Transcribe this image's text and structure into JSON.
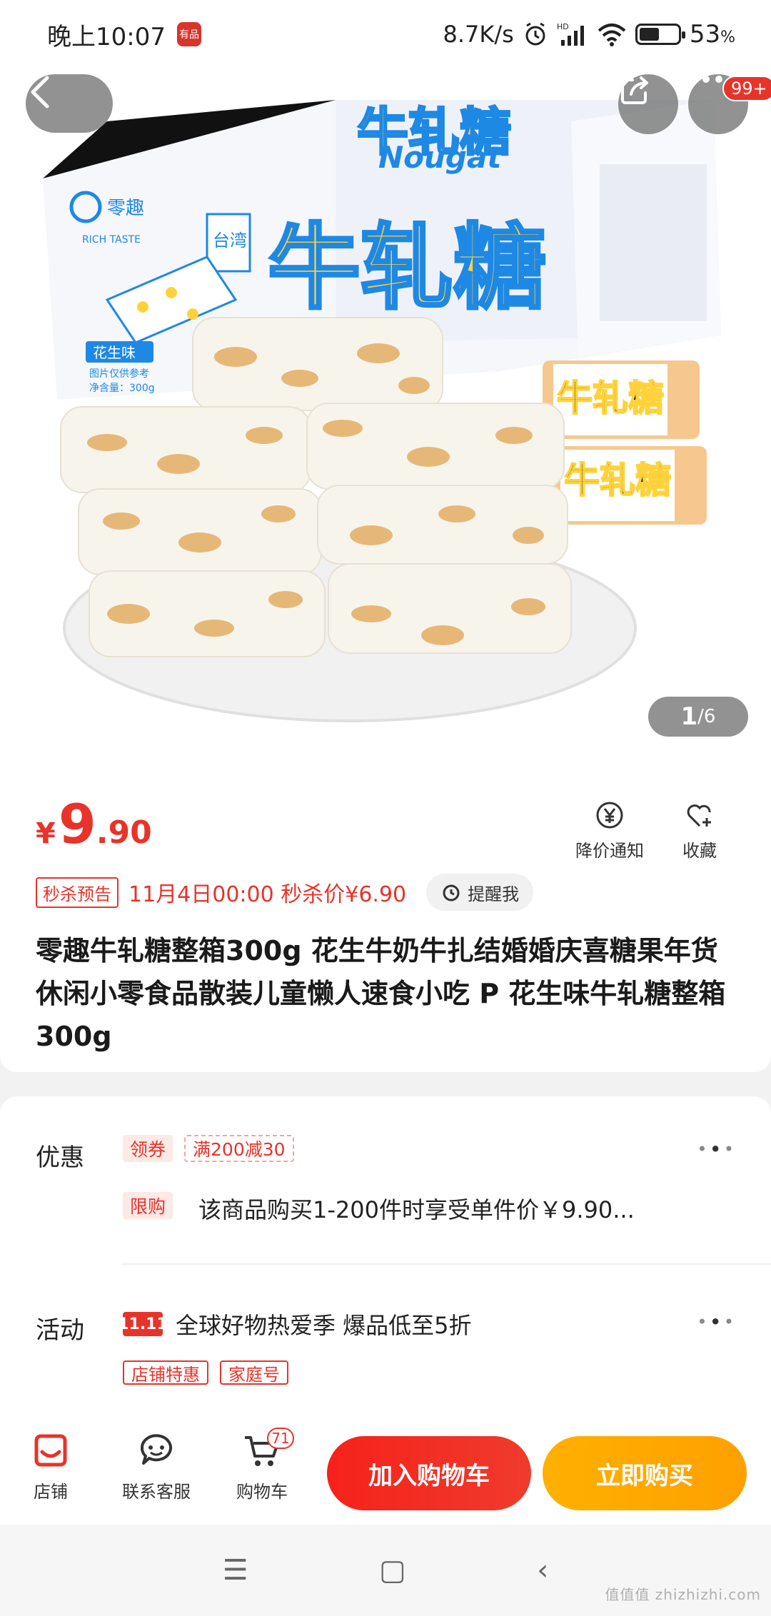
{
  "status_bar": {
    "time": "晚上10:07",
    "app_icon_text": "有品",
    "net_speed": "8.7K/s",
    "hd_label": "HD",
    "battery": "53",
    "battery_unit": "%"
  },
  "hero": {
    "brand_title": "牛轧糖",
    "brand_subtitle": "Nougat",
    "brand_name": "零趣",
    "brand_en": "RICH TASTE",
    "flavor_tag": "花生味",
    "origin_tag": "台湾",
    "net_weight": "净含量：300g",
    "image_note": "图片仅供参考",
    "more_badge": "99+",
    "pager_current": "1",
    "pager_total": "/6"
  },
  "price": {
    "currency": "¥",
    "integer": "9",
    "decimal": ".90",
    "notify_label": "降价通知",
    "favorite_label": "收藏"
  },
  "flash_sale": {
    "tag": "秒杀预告",
    "text": "11月4日00:00 秒杀价¥6.90",
    "remind_label": "提醒我"
  },
  "product_title": "零趣牛轧糖整箱300g 花生牛奶牛扎结婚婚庆喜糖果年货休闲小零食品散装儿童懒人速食小吃 P 花生味牛轧糖整箱300g",
  "promotions": {
    "label": "优惠",
    "coupon_pill": "领券",
    "coupon_value": "满200减30",
    "limit_pill": "限购",
    "limit_text": "该商品购买1-200件时享受单件价￥9.90..."
  },
  "activities": {
    "label": "活动",
    "badge": "11.11",
    "text": "全球好物热爱季 爆品低至5折",
    "tag_shop": "店铺特惠",
    "tag_family": "家庭号"
  },
  "action_bar": {
    "shop_label": "店铺",
    "service_label": "联系客服",
    "cart_label": "购物车",
    "cart_count": "71",
    "add_to_cart": "加入购物车",
    "buy_now": "立即购买"
  },
  "watermark": "值值值 zhizhizhi.com",
  "colors": {
    "accent": "#e8332a",
    "buy": "#ffa800",
    "brand_blue": "#1e88e5",
    "brand_yellow": "#ffd23c"
  }
}
